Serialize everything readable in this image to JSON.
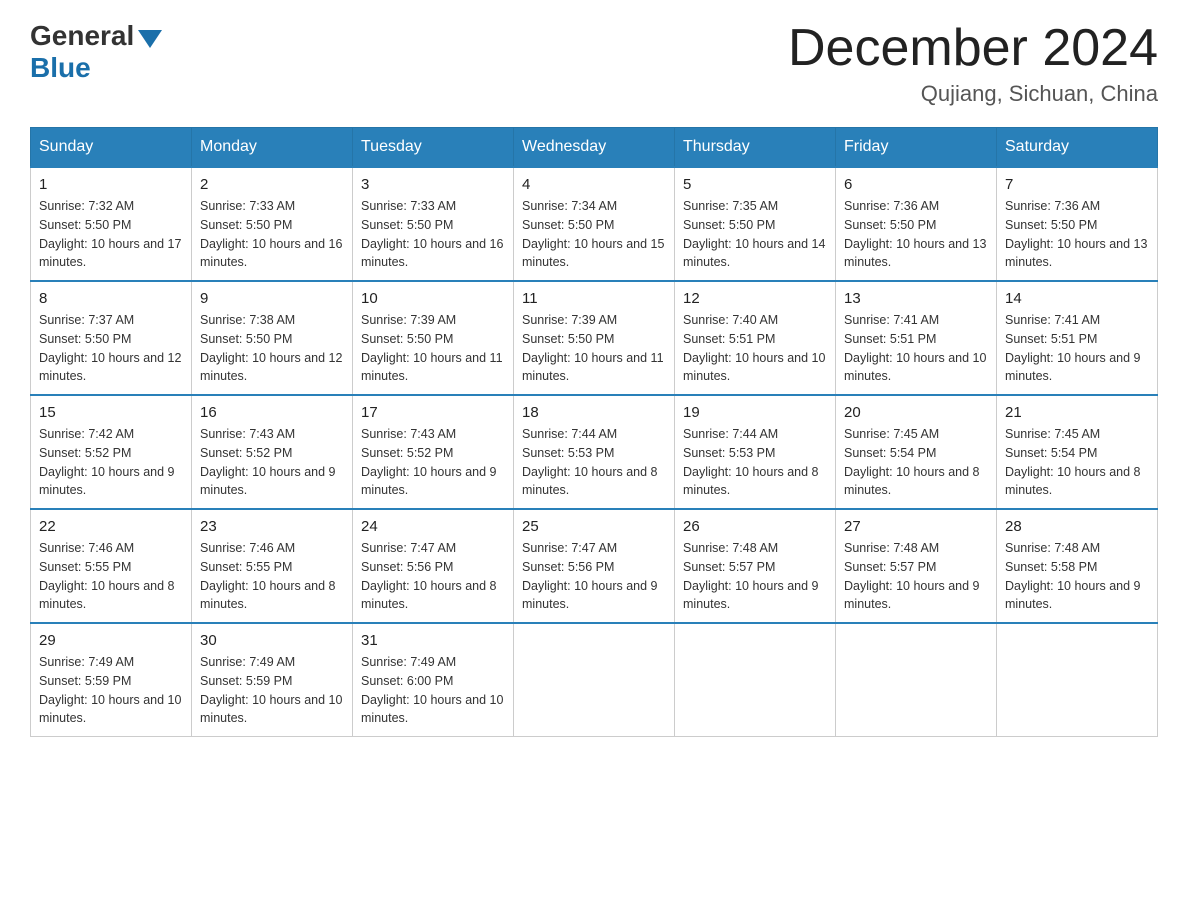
{
  "header": {
    "logo_general": "General",
    "logo_blue": "Blue",
    "month_title": "December 2024",
    "location": "Qujiang, Sichuan, China"
  },
  "days_of_week": [
    "Sunday",
    "Monday",
    "Tuesday",
    "Wednesday",
    "Thursday",
    "Friday",
    "Saturday"
  ],
  "weeks": [
    [
      {
        "day": "1",
        "sunrise": "7:32 AM",
        "sunset": "5:50 PM",
        "daylight": "10 hours and 17 minutes."
      },
      {
        "day": "2",
        "sunrise": "7:33 AM",
        "sunset": "5:50 PM",
        "daylight": "10 hours and 16 minutes."
      },
      {
        "day": "3",
        "sunrise": "7:33 AM",
        "sunset": "5:50 PM",
        "daylight": "10 hours and 16 minutes."
      },
      {
        "day": "4",
        "sunrise": "7:34 AM",
        "sunset": "5:50 PM",
        "daylight": "10 hours and 15 minutes."
      },
      {
        "day": "5",
        "sunrise": "7:35 AM",
        "sunset": "5:50 PM",
        "daylight": "10 hours and 14 minutes."
      },
      {
        "day": "6",
        "sunrise": "7:36 AM",
        "sunset": "5:50 PM",
        "daylight": "10 hours and 13 minutes."
      },
      {
        "day": "7",
        "sunrise": "7:36 AM",
        "sunset": "5:50 PM",
        "daylight": "10 hours and 13 minutes."
      }
    ],
    [
      {
        "day": "8",
        "sunrise": "7:37 AM",
        "sunset": "5:50 PM",
        "daylight": "10 hours and 12 minutes."
      },
      {
        "day": "9",
        "sunrise": "7:38 AM",
        "sunset": "5:50 PM",
        "daylight": "10 hours and 12 minutes."
      },
      {
        "day": "10",
        "sunrise": "7:39 AM",
        "sunset": "5:50 PM",
        "daylight": "10 hours and 11 minutes."
      },
      {
        "day": "11",
        "sunrise": "7:39 AM",
        "sunset": "5:50 PM",
        "daylight": "10 hours and 11 minutes."
      },
      {
        "day": "12",
        "sunrise": "7:40 AM",
        "sunset": "5:51 PM",
        "daylight": "10 hours and 10 minutes."
      },
      {
        "day": "13",
        "sunrise": "7:41 AM",
        "sunset": "5:51 PM",
        "daylight": "10 hours and 10 minutes."
      },
      {
        "day": "14",
        "sunrise": "7:41 AM",
        "sunset": "5:51 PM",
        "daylight": "10 hours and 9 minutes."
      }
    ],
    [
      {
        "day": "15",
        "sunrise": "7:42 AM",
        "sunset": "5:52 PM",
        "daylight": "10 hours and 9 minutes."
      },
      {
        "day": "16",
        "sunrise": "7:43 AM",
        "sunset": "5:52 PM",
        "daylight": "10 hours and 9 minutes."
      },
      {
        "day": "17",
        "sunrise": "7:43 AM",
        "sunset": "5:52 PM",
        "daylight": "10 hours and 9 minutes."
      },
      {
        "day": "18",
        "sunrise": "7:44 AM",
        "sunset": "5:53 PM",
        "daylight": "10 hours and 8 minutes."
      },
      {
        "day": "19",
        "sunrise": "7:44 AM",
        "sunset": "5:53 PM",
        "daylight": "10 hours and 8 minutes."
      },
      {
        "day": "20",
        "sunrise": "7:45 AM",
        "sunset": "5:54 PM",
        "daylight": "10 hours and 8 minutes."
      },
      {
        "day": "21",
        "sunrise": "7:45 AM",
        "sunset": "5:54 PM",
        "daylight": "10 hours and 8 minutes."
      }
    ],
    [
      {
        "day": "22",
        "sunrise": "7:46 AM",
        "sunset": "5:55 PM",
        "daylight": "10 hours and 8 minutes."
      },
      {
        "day": "23",
        "sunrise": "7:46 AM",
        "sunset": "5:55 PM",
        "daylight": "10 hours and 8 minutes."
      },
      {
        "day": "24",
        "sunrise": "7:47 AM",
        "sunset": "5:56 PM",
        "daylight": "10 hours and 8 minutes."
      },
      {
        "day": "25",
        "sunrise": "7:47 AM",
        "sunset": "5:56 PM",
        "daylight": "10 hours and 9 minutes."
      },
      {
        "day": "26",
        "sunrise": "7:48 AM",
        "sunset": "5:57 PM",
        "daylight": "10 hours and 9 minutes."
      },
      {
        "day": "27",
        "sunrise": "7:48 AM",
        "sunset": "5:57 PM",
        "daylight": "10 hours and 9 minutes."
      },
      {
        "day": "28",
        "sunrise": "7:48 AM",
        "sunset": "5:58 PM",
        "daylight": "10 hours and 9 minutes."
      }
    ],
    [
      {
        "day": "29",
        "sunrise": "7:49 AM",
        "sunset": "5:59 PM",
        "daylight": "10 hours and 10 minutes."
      },
      {
        "day": "30",
        "sunrise": "7:49 AM",
        "sunset": "5:59 PM",
        "daylight": "10 hours and 10 minutes."
      },
      {
        "day": "31",
        "sunrise": "7:49 AM",
        "sunset": "6:00 PM",
        "daylight": "10 hours and 10 minutes."
      },
      null,
      null,
      null,
      null
    ]
  ],
  "labels": {
    "sunrise_prefix": "Sunrise: ",
    "sunset_prefix": "Sunset: ",
    "daylight_prefix": "Daylight: "
  }
}
